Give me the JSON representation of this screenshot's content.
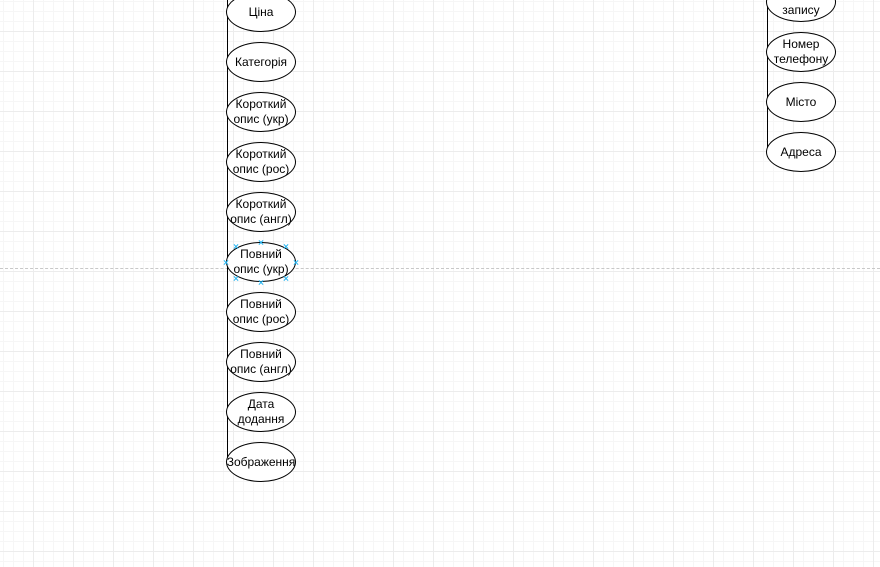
{
  "left_column": {
    "nodes": [
      {
        "label": "Ціна"
      },
      {
        "label": "Категорія"
      },
      {
        "label": "Короткий\nопис (укр)"
      },
      {
        "label": "Короткий\nопис (рос)"
      },
      {
        "label": "Короткий\nопис (англ)"
      },
      {
        "label": "Повний\nопис (укр)",
        "selected": true
      },
      {
        "label": "Повний\nопис (рос)"
      },
      {
        "label": "Повний\nопис (англ)"
      },
      {
        "label": "Дата\nдодання"
      },
      {
        "label": "Зображення"
      }
    ]
  },
  "right_column": {
    "nodes": [
      {
        "label": "запису"
      },
      {
        "label": "Номер\nтелефону"
      },
      {
        "label": "Місто"
      },
      {
        "label": "Адреса"
      }
    ]
  },
  "colors": {
    "selection_handle": "#29b6f2",
    "stroke": "#000000"
  }
}
